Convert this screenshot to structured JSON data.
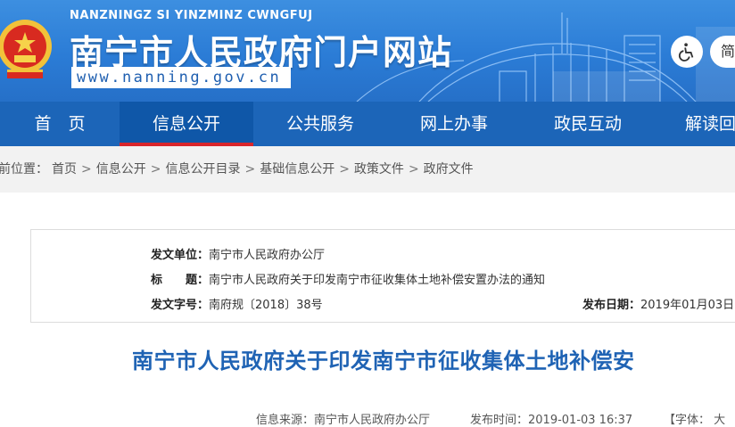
{
  "header": {
    "pinyin": "NANZNINGZ SI YINZMINZ CWNGFUJ",
    "title": "南宁市人民政府门户网站",
    "url": "www.nanning.gov.cn",
    "lang_label": "简"
  },
  "nav": {
    "items": [
      {
        "label": "首　页"
      },
      {
        "label": "信息公开"
      },
      {
        "label": "公共服务"
      },
      {
        "label": "网上办事"
      },
      {
        "label": "政民互动"
      },
      {
        "label": "解读回"
      }
    ]
  },
  "breadcrumb": {
    "prefix": "前位置：",
    "items": [
      "首页",
      "信息公开",
      "信息公开目录",
      "基础信息公开",
      "政策文件",
      "政府文件"
    ],
    "separator": ">"
  },
  "info": {
    "issuer_label": "发文单位：",
    "issuer": "南宁市人民政府办公厅",
    "title_label": "标　　题：",
    "title": "南宁市人民政府关于印发南宁市征收集体土地补偿安置办法的通知",
    "docno_label": "发文字号：",
    "docno": "南府规〔2018〕38号",
    "date_label": "发布日期：",
    "date": "2019年01月03日"
  },
  "article": {
    "title": "南宁市人民政府关于印发南宁市征收集体土地补偿安"
  },
  "meta": {
    "source": "信息来源：南宁市人民政府办公厅",
    "time": "发布时间：2019-01-03 16:37",
    "font": "【字体：  大"
  },
  "colors": {
    "header_blue": "#2b7cd6",
    "nav_blue": "#1c65b8",
    "active_underline": "#d8252b",
    "title_blue": "#1f63b4"
  }
}
